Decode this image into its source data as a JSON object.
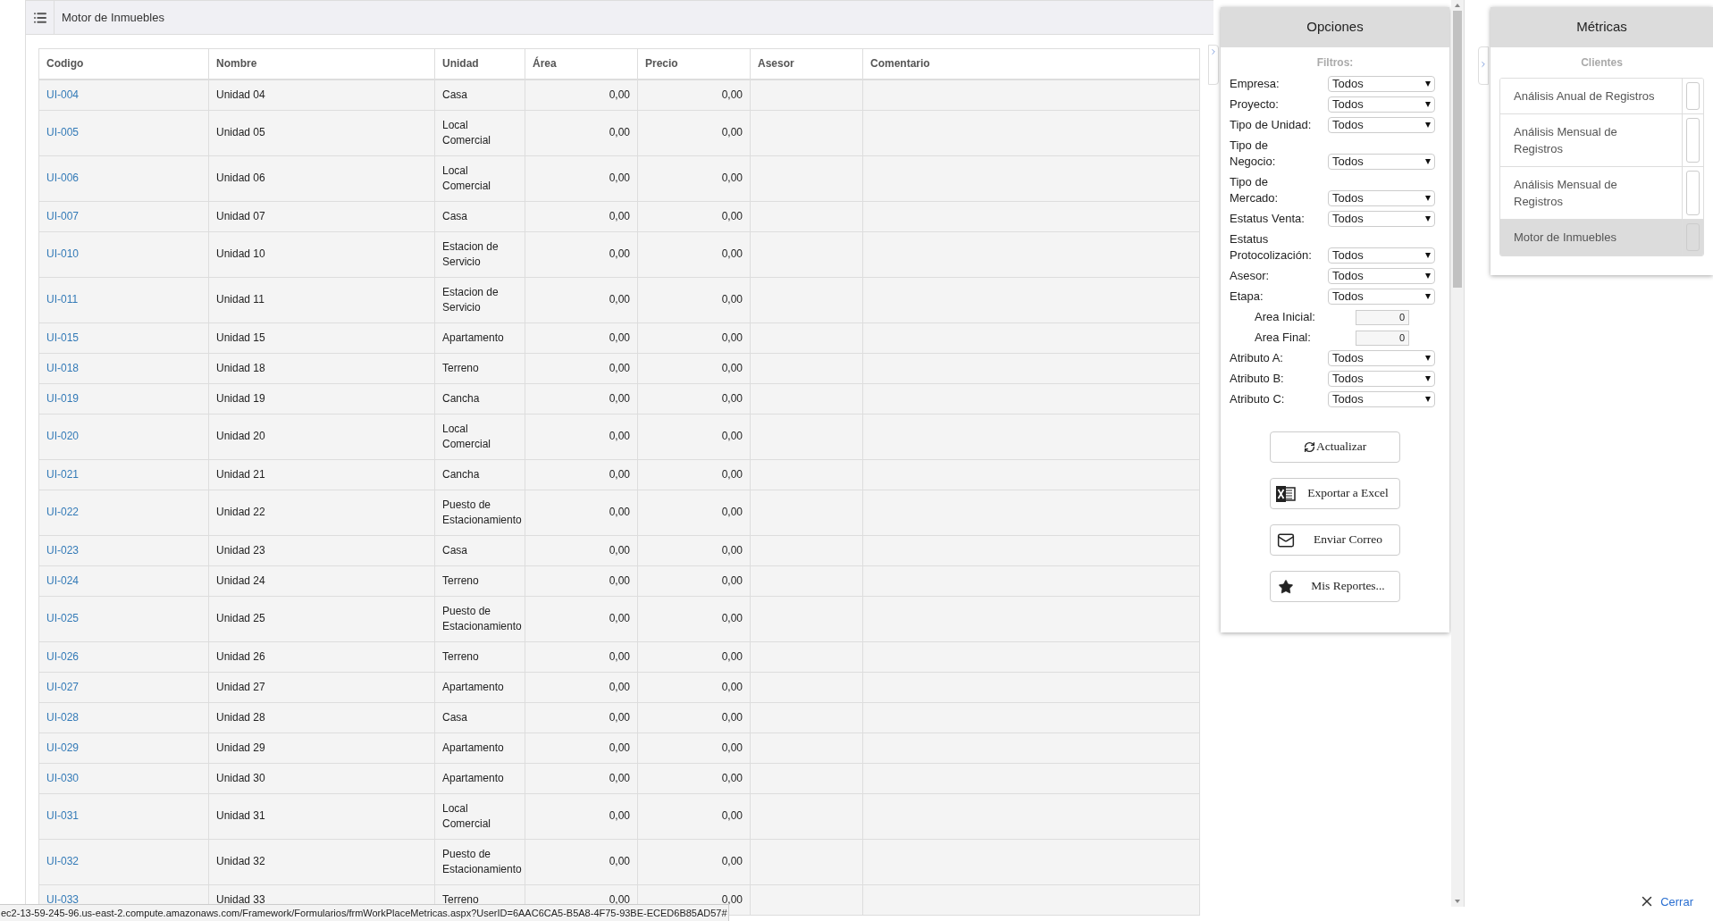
{
  "header": {
    "title": "Motor de Inmuebles"
  },
  "table": {
    "columns": [
      "Codigo",
      "Nombre",
      "Unidad",
      "Área",
      "Precio",
      "Asesor",
      "Comentario"
    ],
    "rows": [
      {
        "codigo": "UI-004",
        "nombre": "Unidad 04",
        "unidad": "Casa",
        "area": "0,00",
        "precio": "0,00"
      },
      {
        "codigo": "UI-005",
        "nombre": "Unidad 05",
        "unidad": "Local Comercial",
        "area": "0,00",
        "precio": "0,00"
      },
      {
        "codigo": "UI-006",
        "nombre": "Unidad 06",
        "unidad": "Local Comercial",
        "area": "0,00",
        "precio": "0,00"
      },
      {
        "codigo": "UI-007",
        "nombre": "Unidad 07",
        "unidad": "Casa",
        "area": "0,00",
        "precio": "0,00"
      },
      {
        "codigo": "UI-010",
        "nombre": "Unidad 10",
        "unidad": "Estacion de Servicio",
        "area": "0,00",
        "precio": "0,00"
      },
      {
        "codigo": "UI-011",
        "nombre": "Unidad 11",
        "unidad": "Estacion de Servicio",
        "area": "0,00",
        "precio": "0,00"
      },
      {
        "codigo": "UI-015",
        "nombre": "Unidad 15",
        "unidad": "Apartamento",
        "area": "0,00",
        "precio": "0,00"
      },
      {
        "codigo": "UI-018",
        "nombre": "Unidad 18",
        "unidad": "Terreno",
        "area": "0,00",
        "precio": "0,00"
      },
      {
        "codigo": "UI-019",
        "nombre": "Unidad 19",
        "unidad": "Cancha",
        "area": "0,00",
        "precio": "0,00"
      },
      {
        "codigo": "UI-020",
        "nombre": "Unidad 20",
        "unidad": "Local Comercial",
        "area": "0,00",
        "precio": "0,00"
      },
      {
        "codigo": "UI-021",
        "nombre": "Unidad 21",
        "unidad": "Cancha",
        "area": "0,00",
        "precio": "0,00"
      },
      {
        "codigo": "UI-022",
        "nombre": "Unidad 22",
        "unidad": "Puesto de Estacionamiento",
        "area": "0,00",
        "precio": "0,00"
      },
      {
        "codigo": "UI-023",
        "nombre": "Unidad 23",
        "unidad": "Casa",
        "area": "0,00",
        "precio": "0,00"
      },
      {
        "codigo": "UI-024",
        "nombre": "Unidad 24",
        "unidad": "Terreno",
        "area": "0,00",
        "precio": "0,00"
      },
      {
        "codigo": "UI-025",
        "nombre": "Unidad 25",
        "unidad": "Puesto de Estacionamiento",
        "area": "0,00",
        "precio": "0,00"
      },
      {
        "codigo": "UI-026",
        "nombre": "Unidad 26",
        "unidad": "Terreno",
        "area": "0,00",
        "precio": "0,00"
      },
      {
        "codigo": "UI-027",
        "nombre": "Unidad 27",
        "unidad": "Apartamento",
        "area": "0,00",
        "precio": "0,00"
      },
      {
        "codigo": "UI-028",
        "nombre": "Unidad 28",
        "unidad": "Casa",
        "area": "0,00",
        "precio": "0,00"
      },
      {
        "codigo": "UI-029",
        "nombre": "Unidad 29",
        "unidad": "Apartamento",
        "area": "0,00",
        "precio": "0,00"
      },
      {
        "codigo": "UI-030",
        "nombre": "Unidad 30",
        "unidad": "Apartamento",
        "area": "0,00",
        "precio": "0,00"
      },
      {
        "codigo": "UI-031",
        "nombre": "Unidad 31",
        "unidad": "Local Comercial",
        "area": "0,00",
        "precio": "0,00"
      },
      {
        "codigo": "UI-032",
        "nombre": "Unidad 32",
        "unidad": "Puesto de Estacionamiento",
        "area": "0,00",
        "precio": "0,00"
      },
      {
        "codigo": "UI-033",
        "nombre": "Unidad 33",
        "unidad": "Terreno",
        "area": "0,00",
        "precio": "0,00"
      }
    ]
  },
  "options": {
    "title": "Opciones",
    "section": "Filtros:",
    "filters": [
      {
        "kind": "select",
        "label": "Empresa:",
        "value": "Todos"
      },
      {
        "kind": "select",
        "label": "Proyecto:",
        "value": "Todos"
      },
      {
        "kind": "select",
        "label": "Tipo de Unidad:",
        "value": "Todos"
      },
      {
        "kind": "select",
        "label": "Tipo de Negocio:",
        "value": "Todos"
      },
      {
        "kind": "select",
        "label": "Tipo de Mercado:",
        "value": "Todos"
      },
      {
        "kind": "select",
        "label": "Estatus Venta:",
        "value": "Todos"
      },
      {
        "kind": "select",
        "label": "Estatus Protocolización:",
        "value": "Todos"
      },
      {
        "kind": "select",
        "label": "Asesor:",
        "value": "Todos"
      },
      {
        "kind": "select",
        "label": "Etapa:",
        "value": "Todos"
      },
      {
        "kind": "number",
        "label": "Area Inicial:",
        "value": "0"
      },
      {
        "kind": "number",
        "label": "Area Final:",
        "value": "0"
      },
      {
        "kind": "select",
        "label": "Atributo A:",
        "value": "Todos"
      },
      {
        "kind": "select",
        "label": "Atributo B:",
        "value": "Todos"
      },
      {
        "kind": "select",
        "label": "Atributo C:",
        "value": "Todos"
      }
    ],
    "buttons": [
      {
        "kind": "refresh",
        "label": "Actualizar"
      },
      {
        "kind": "excel",
        "label": "Exportar a Excel"
      },
      {
        "kind": "mail",
        "label": "Enviar Correo"
      },
      {
        "kind": "star",
        "label": "Mis Reportes..."
      }
    ]
  },
  "metrics": {
    "title": "Métricas",
    "section": "Clientes",
    "items": [
      {
        "label": "Análisis Anual de Registros",
        "selected": false
      },
      {
        "label": "Análisis Mensual de Registros",
        "selected": false
      },
      {
        "label": "Análisis Mensual de Registros",
        "selected": false
      },
      {
        "label": "Motor de Inmuebles",
        "selected": true
      }
    ]
  },
  "close": {
    "label": "Cerrar"
  },
  "status_url": "ec2-13-59-245-96.us-east-2.compute.amazonaws.com/Framework/Formularios/frmWorkPlaceMetricas.aspx?UserID=6AAC6CA5-B5A8-4F75-93BE-ECED6B85AD57#"
}
